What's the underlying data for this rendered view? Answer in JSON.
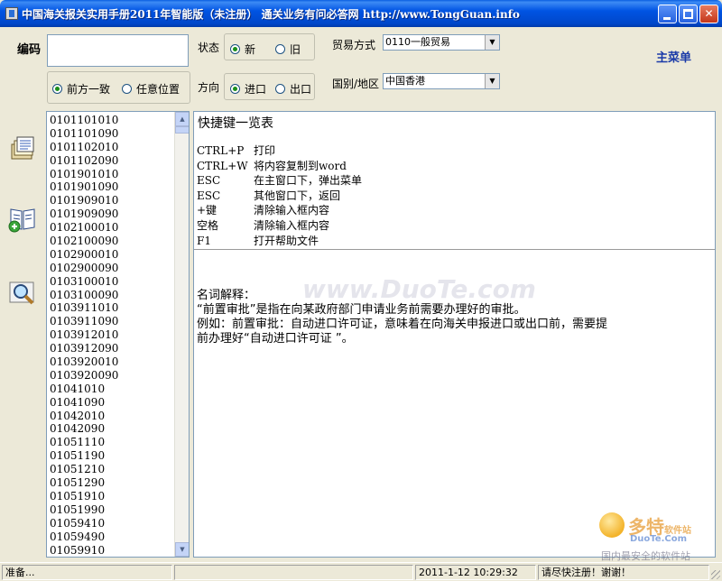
{
  "window": {
    "title": "中国海关报关实用手册2011年智能版（未注册）   通关业务有问必答网 http://www.TongGuan.info"
  },
  "search": {
    "code_label": "编码",
    "code_value": "",
    "match_options": [
      "前方一致",
      "任意位置"
    ],
    "match_selected": 0
  },
  "status": {
    "label": "状态",
    "options": [
      "新",
      "旧"
    ],
    "selected": 0
  },
  "direction": {
    "label": "方向",
    "options": [
      "进口",
      "出口"
    ],
    "selected": 0
  },
  "trade_mode": {
    "label": "贸易方式",
    "value": "0110一般贸易"
  },
  "region": {
    "label": "国别/地区",
    "value": "中国香港"
  },
  "main_menu_label": "主菜单",
  "side_icons": [
    "document-stack-icon",
    "book-add-icon",
    "magnifier-icon"
  ],
  "code_list": [
    "0101101010",
    "0101101090",
    "0101102010",
    "0101102090",
    "0101901010",
    "0101901090",
    "0101909010",
    "0101909090",
    "0102100010",
    "0102100090",
    "0102900010",
    "0102900090",
    "0103100010",
    "0103100090",
    "0103911010",
    "0103911090",
    "0103912010",
    "0103912090",
    "0103920010",
    "0103920090",
    "01041010",
    "01041090",
    "01042010",
    "01042090",
    "01051110",
    "01051190",
    "01051210",
    "01051290",
    "01051910",
    "01051990",
    "01059410",
    "01059490",
    "01059910"
  ],
  "content": {
    "title": "快捷键一览表",
    "shortcuts": [
      {
        "key": "CTRL+P",
        "desc": "打印"
      },
      {
        "key": "CTRL+W",
        "desc": "将内容复制到word"
      },
      {
        "key": "ESC",
        "desc": "在主窗口下，弹出菜单"
      },
      {
        "key": "ESC",
        "desc": "其他窗口下，返回"
      },
      {
        "key": "+键",
        "desc": "清除输入框内容"
      },
      {
        "key": "空格",
        "desc": "清除输入框内容"
      },
      {
        "key": "F1",
        "desc": "打开帮助文件"
      }
    ],
    "glossary_lines": [
      "名词解释：",
      "“前置审批”是指在向某政府部门申请业务前需要办理好的审批。",
      "例如：前置审批：自动进口许可证，意味着在向海关申报进口或出口前，需要提",
      "前办理好“自动进口许可证 ”。"
    ],
    "watermark": "www.DuoTe.com"
  },
  "corner_logo": {
    "word": "多特",
    "suffix": "软件站",
    "site": "DuoTe.Com",
    "sub": "国内最安全的软件站"
  },
  "statusbar": {
    "ready": "准备...",
    "datetime": "2011-1-12  10:29:32",
    "register_msg": "请尽快注册！谢谢！"
  }
}
